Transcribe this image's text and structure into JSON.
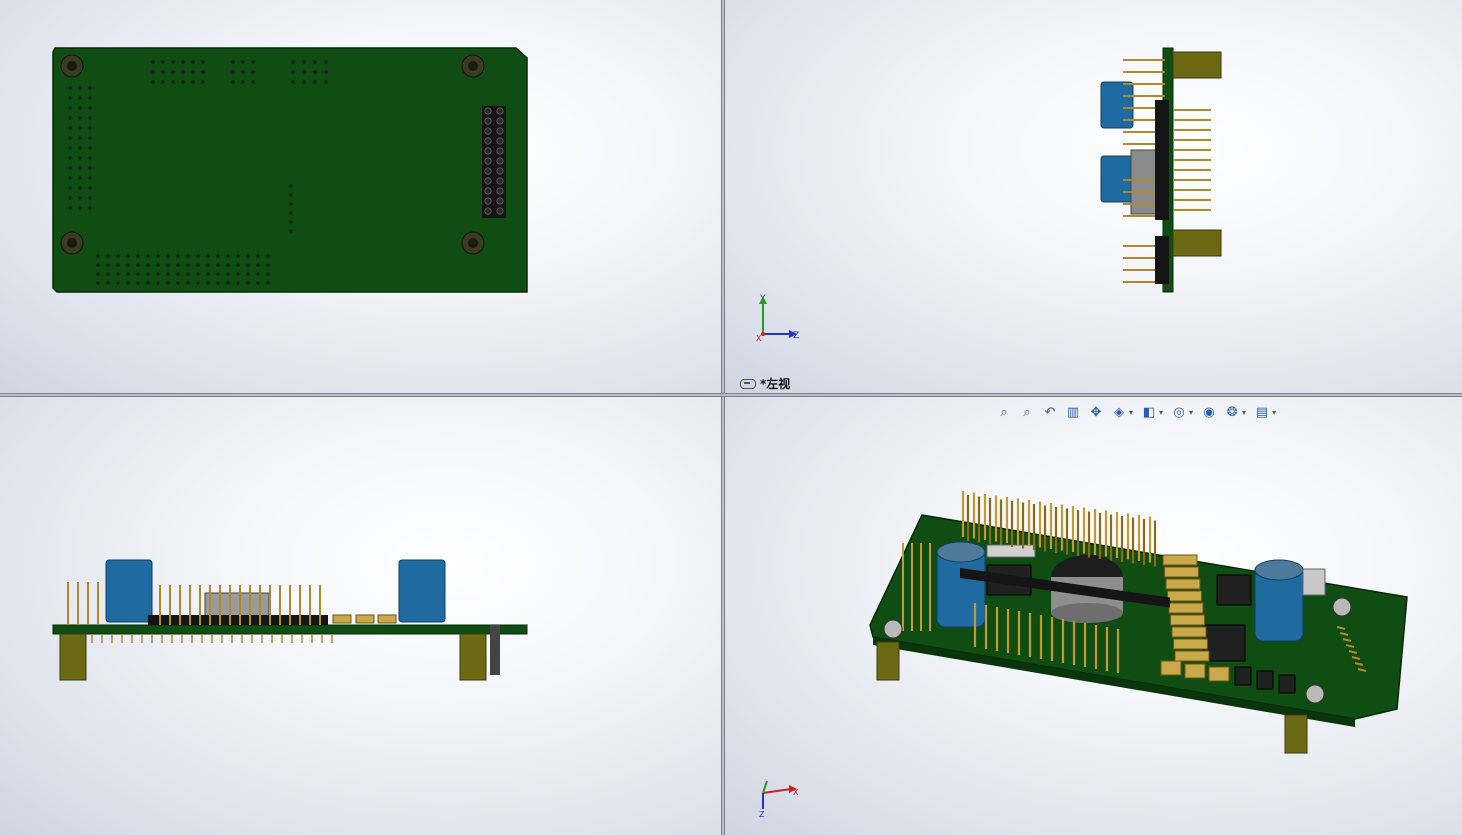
{
  "viewports": {
    "top_left": {
      "name": "bottom-view"
    },
    "top_right": {
      "name": "left-view",
      "label": "*左视"
    },
    "bottom_left": {
      "name": "front-view"
    },
    "bottom_right": {
      "name": "isometric-view"
    }
  },
  "triad": {
    "y": "Y",
    "z": "Z",
    "x": "X"
  },
  "hud_toolbar": [
    {
      "name": "zoom-to-fit-icon",
      "glyph": "⌕"
    },
    {
      "name": "zoom-to-area-icon",
      "glyph": "⌕"
    },
    {
      "name": "previous-view-icon",
      "glyph": "↶"
    },
    {
      "name": "section-view-icon",
      "glyph": "▥"
    },
    {
      "name": "dynamic-annotation-icon",
      "glyph": "✥"
    },
    {
      "name": "view-orientation-icon",
      "glyph": "◈",
      "dropdown": true
    },
    {
      "name": "display-style-icon",
      "glyph": "◧",
      "dropdown": true
    },
    {
      "name": "hide-show-items-icon",
      "glyph": "◎",
      "dropdown": true
    },
    {
      "name": "edit-appearance-icon",
      "glyph": "◉"
    },
    {
      "name": "apply-scene-icon",
      "glyph": "❂",
      "dropdown": true
    },
    {
      "name": "view-settings-icon",
      "glyph": "▤",
      "dropdown": true
    }
  ],
  "colors": {
    "pcb_green": "#0f4d12",
    "pcb_edge": "#0a350c",
    "capacitor_blue": "#1f6aa0",
    "standoff_brass": "#6b6914",
    "pin_gold": "#b08a2a",
    "header_black": "#151515"
  }
}
